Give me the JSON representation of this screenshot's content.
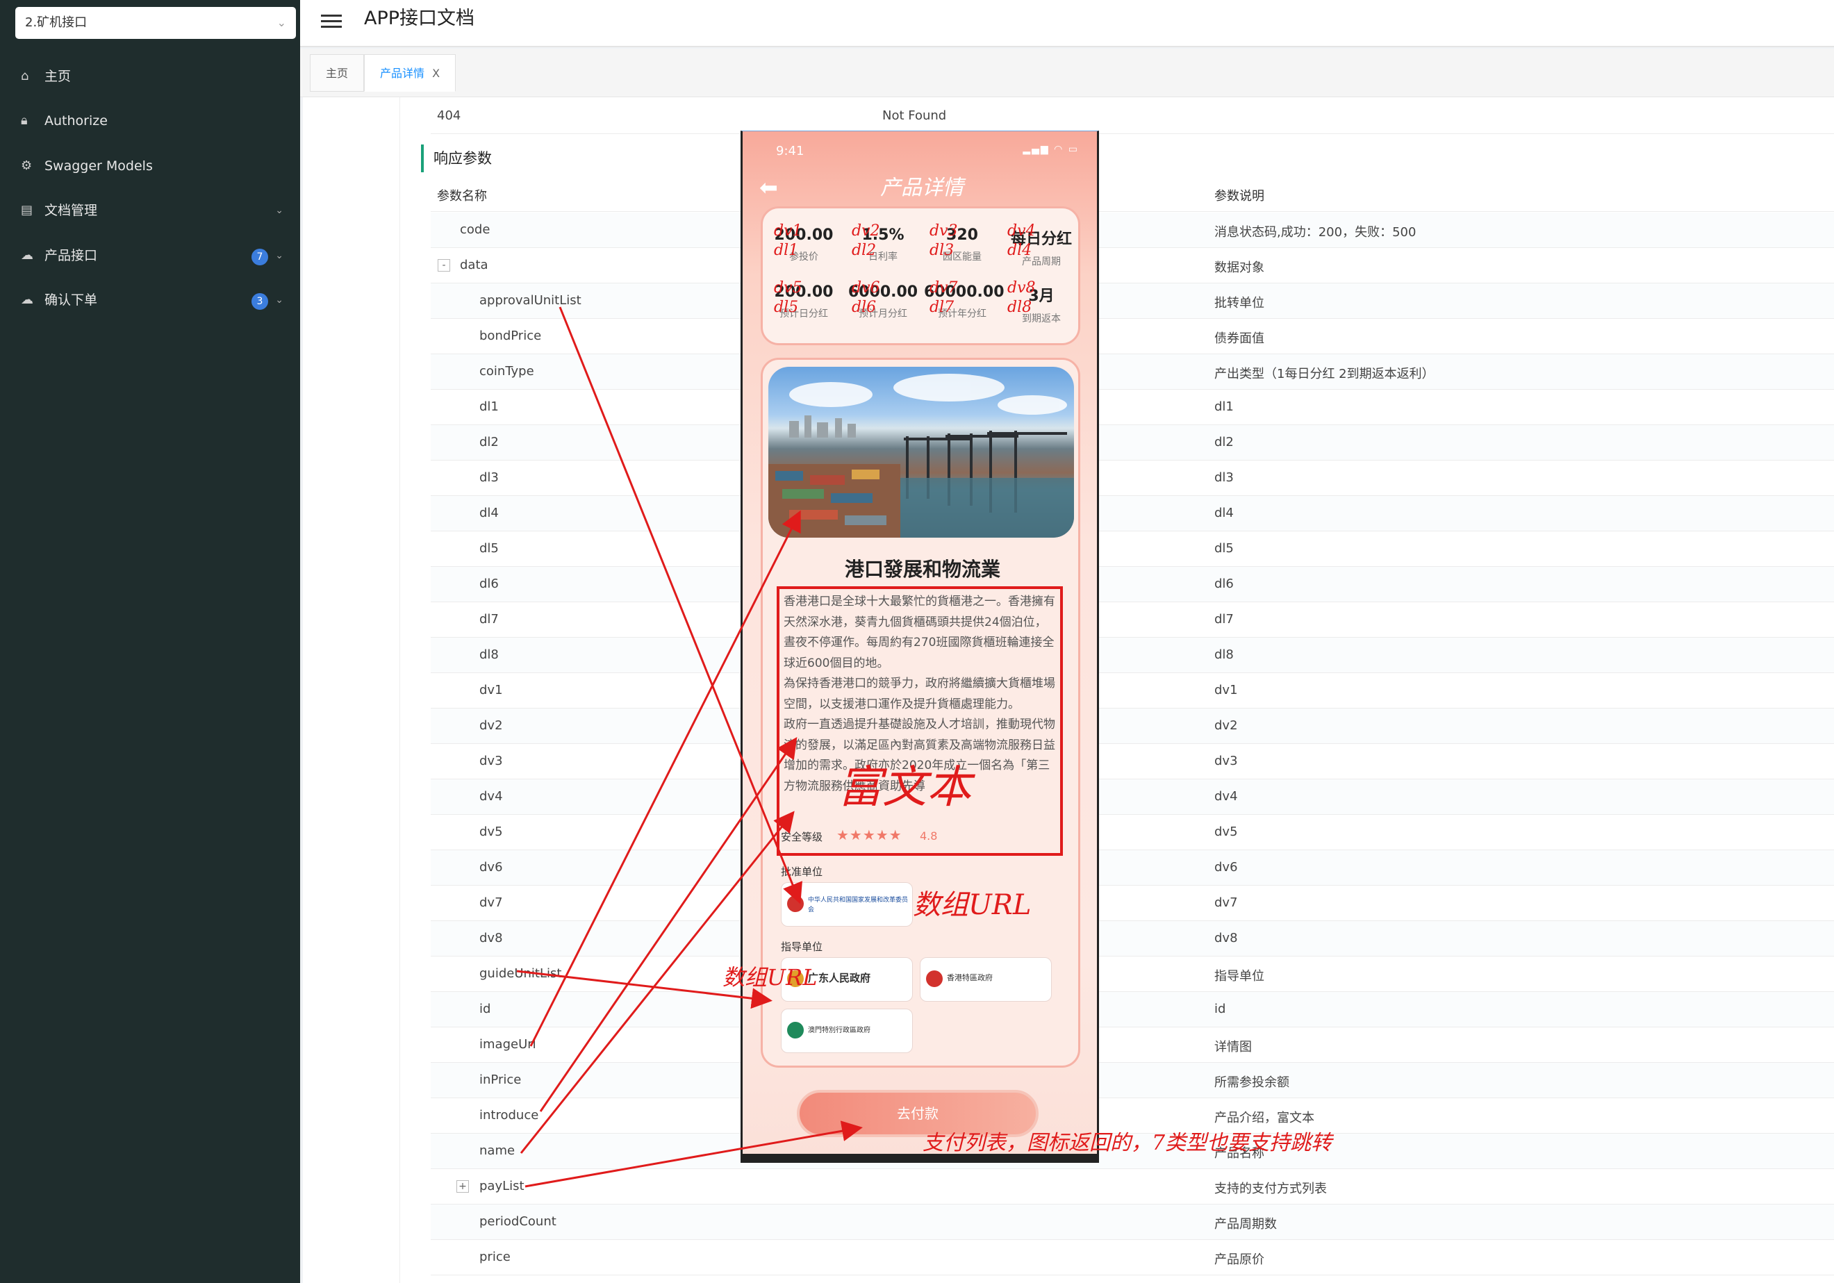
{
  "sidebar": {
    "project": "2.矿机接口",
    "items": [
      {
        "label": "主页",
        "icon": "home-icon"
      },
      {
        "label": "Authorize",
        "icon": "lock-icon"
      },
      {
        "label": "Swagger Models",
        "icon": "gear-icon"
      },
      {
        "label": "文档管理",
        "icon": "document-icon"
      },
      {
        "label": "产品接口",
        "icon": "cloud-icon",
        "badge": "7"
      },
      {
        "label": "确认下单",
        "icon": "cloud-icon",
        "badge": "3"
      }
    ]
  },
  "header": {
    "title": "APP接口文档"
  },
  "tabs": [
    {
      "label": "主页"
    },
    {
      "label": "产品详情",
      "close": "X"
    }
  ],
  "response": {
    "status_code": "404",
    "status_text": "Not Found",
    "section_title": "响应参数",
    "col_name": "参数名称",
    "col_desc": "参数说明",
    "rows": [
      {
        "name": "code",
        "desc": "消息状态码,成功：200，失败：500"
      },
      {
        "name": "data",
        "desc": "数据对象",
        "toggle": "-"
      },
      {
        "name": "approvalUnitList",
        "desc": "批转单位"
      },
      {
        "name": "bondPrice",
        "desc": "债券面值"
      },
      {
        "name": "coinType",
        "desc": "产出类型（1每日分红 2到期返本返利）"
      },
      {
        "name": "dl1",
        "desc": "dl1"
      },
      {
        "name": "dl2",
        "desc": "dl2"
      },
      {
        "name": "dl3",
        "desc": "dl3"
      },
      {
        "name": "dl4",
        "desc": "dl4"
      },
      {
        "name": "dl5",
        "desc": "dl5"
      },
      {
        "name": "dl6",
        "desc": "dl6"
      },
      {
        "name": "dl7",
        "desc": "dl7"
      },
      {
        "name": "dl8",
        "desc": "dl8"
      },
      {
        "name": "dv1",
        "desc": "dv1"
      },
      {
        "name": "dv2",
        "desc": "dv2"
      },
      {
        "name": "dv3",
        "desc": "dv3"
      },
      {
        "name": "dv4",
        "desc": "dv4"
      },
      {
        "name": "dv5",
        "desc": "dv5"
      },
      {
        "name": "dv6",
        "desc": "dv6"
      },
      {
        "name": "dv7",
        "desc": "dv7"
      },
      {
        "name": "dv8",
        "desc": "dv8"
      },
      {
        "name": "guideUnitList",
        "desc": "指导单位"
      },
      {
        "name": "id",
        "desc": "id"
      },
      {
        "name": "imageUrl",
        "desc": "详情图"
      },
      {
        "name": "inPrice",
        "desc": "所需参投余额"
      },
      {
        "name": "introduce",
        "desc": "产品介绍，富文本"
      },
      {
        "name": "name",
        "desc": "产品名称"
      },
      {
        "name": "payList",
        "desc": "支持的支付方式列表",
        "toggle": "+"
      },
      {
        "name": "periodCount",
        "desc": "产品周期数"
      },
      {
        "name": "price",
        "desc": "产品原价"
      }
    ]
  },
  "phone": {
    "time": "9:41",
    "title": "产品详情",
    "stats": [
      {
        "value": "200.00",
        "label": "参投价"
      },
      {
        "value": "1.5%",
        "label": "日利率"
      },
      {
        "value": "320",
        "label": "园区能量"
      },
      {
        "value": "每日分红",
        "label": "产品周期"
      },
      {
        "value": "200.00",
        "label": "预计日分红"
      },
      {
        "value": "6000.00",
        "label": "预计月分红"
      },
      {
        "value": "60000.00",
        "label": "预计年分红"
      },
      {
        "value": "3月",
        "label": "到期返本"
      }
    ],
    "stat_annotations": {
      "dv": [
        "dv1",
        "dv2",
        "dv3",
        "dv4",
        "dv5",
        "dv6",
        "dv7",
        "dv8"
      ],
      "dl": [
        "dl1",
        "dl2",
        "dl3",
        "dl4",
        "dl5",
        "dl6",
        "dl7",
        "dl8"
      ]
    },
    "product_name": "港口發展和物流業",
    "intro_paragraphs": [
      "香港港口是全球十大最繁忙的貨櫃港之一。香港擁有天然深水港，葵青九個貨櫃碼頭共提供24個泊位，晝夜不停運作。每周約有270班國際貨櫃班輪連接全球近600個目的地。",
      "為保持香港港口的競爭力，政府將繼續擴大貨櫃堆場空間，以支援港口運作及提升貨櫃處理能力。",
      "政府一直透過提升基礎設施及人才培訓，推動現代物流的發展，以滿足區內對高質素及高端物流服務日益增加的需求。政府亦於2020年成立一個名為「第三方物流服務供應商資助先導"
    ],
    "safety_label": "安全等级",
    "stars": "★★★★★",
    "rating": "4.8",
    "approval_label": "批准单位",
    "approval_logo": "中华人民共和国国家发展和改革委员会",
    "guide_label": "指导单位",
    "guide_logos": [
      "广东人民政府",
      "香港特區政府",
      "澳門特別行政區政府"
    ],
    "pay_button": "去付款"
  },
  "annotations": {
    "rich_text": "富文本",
    "array_url_1": "数组URL",
    "array_url_2": "数组URL",
    "pay_note": "支付列表，图标返回的，7类型也要支持跳转"
  },
  "colors": {
    "sidebar_bg": "#1f2d2d",
    "accent": "#1aa179",
    "annotation": "#e01b1b",
    "link": "#1890ff"
  }
}
